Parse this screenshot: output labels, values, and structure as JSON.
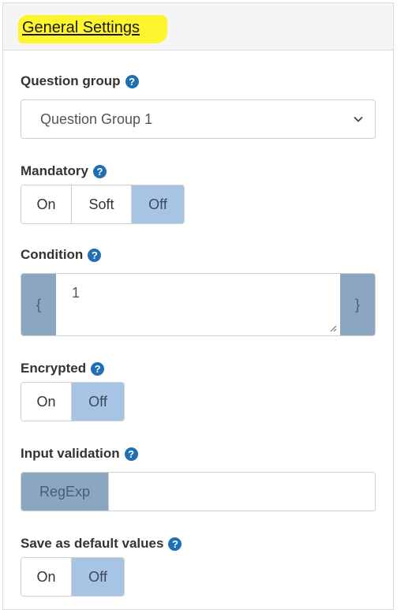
{
  "panel": {
    "title": "General Settings"
  },
  "question_group": {
    "label": "Question group",
    "selected": "Question Group 1"
  },
  "mandatory": {
    "label": "Mandatory",
    "options": [
      "On",
      "Soft",
      "Off"
    ],
    "selected": "Off"
  },
  "condition": {
    "label": "Condition",
    "open_brace": "{",
    "value": "1",
    "close_brace": "}"
  },
  "encrypted": {
    "label": "Encrypted",
    "options": [
      "On",
      "Off"
    ],
    "selected": "Off"
  },
  "input_validation": {
    "label": "Input validation",
    "addon": "RegExp",
    "value": ""
  },
  "save_default": {
    "label": "Save as default values",
    "options": [
      "On",
      "Off"
    ],
    "selected": "Off"
  },
  "icons": {
    "help": "?"
  },
  "colors": {
    "highlight": "#fff52e",
    "help_icon": "#1f6fb2",
    "active_toggle": "#a7c4e4",
    "addon": "#8aa6c1"
  }
}
